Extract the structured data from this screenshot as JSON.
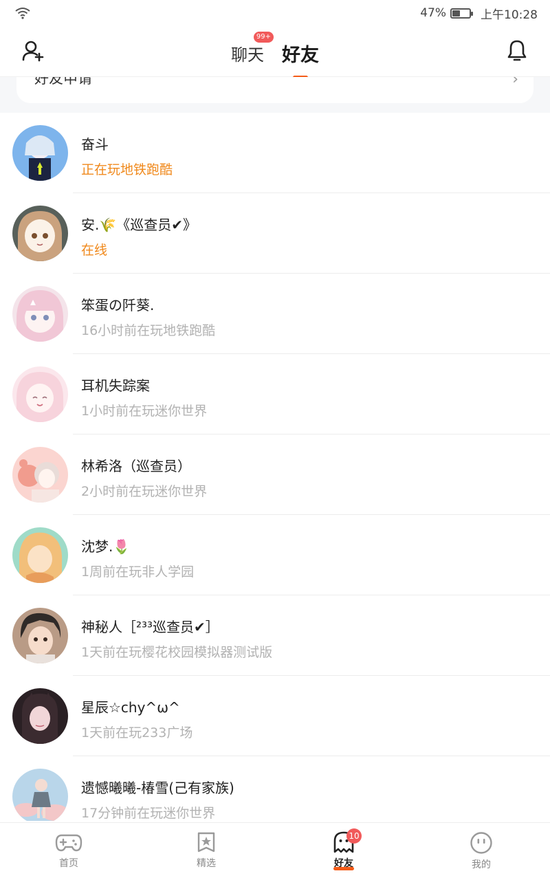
{
  "status_bar": {
    "battery": "47%",
    "time": "上午10:28",
    "battery_level": 0.47
  },
  "header": {
    "tabs": [
      {
        "label": "聊天",
        "badge": "99+"
      },
      {
        "label": "好友"
      }
    ]
  },
  "friend_request": {
    "label": "好友申请"
  },
  "friends": [
    {
      "name": "奋斗",
      "status": "正在玩地铁跑酷",
      "status_active": true
    },
    {
      "name": "安.🌾《巡查员✔》",
      "status": "在线",
      "status_active": true
    },
    {
      "name": "笨蛋の阡葵.",
      "status": "16小时前在玩地铁跑酷",
      "status_active": false
    },
    {
      "name": "耳机失踪案",
      "status": "1小时前在玩迷你世界",
      "status_active": false
    },
    {
      "name": "林希洛（巡查员）",
      "status": "2小时前在玩迷你世界",
      "status_active": false
    },
    {
      "name": "沈梦.🌷",
      "status": "1周前在玩非人学园",
      "status_active": false
    },
    {
      "name": "神秘人［²³³巡查员✔］",
      "status": "1天前在玩樱花校园模拟器测试版",
      "status_active": false
    },
    {
      "name": "星辰☆chy^ω^",
      "status": "1天前在玩233广场",
      "status_active": false
    },
    {
      "name": "遗憾曦曦-椿雪(己有家族)",
      "status": "17分钟前在玩迷你世界",
      "status_active": false
    }
  ],
  "bottom_nav": [
    {
      "label": "首页",
      "icon": "gamepad-icon"
    },
    {
      "label": "精选",
      "icon": "star-box-icon"
    },
    {
      "label": "好友",
      "icon": "ghost-icon",
      "badge": "10",
      "active": true
    },
    {
      "label": "我的",
      "icon": "face-icon"
    }
  ],
  "colors": {
    "accent": "#f45b18",
    "online": "#f0891c",
    "badge": "#f15a5a"
  }
}
